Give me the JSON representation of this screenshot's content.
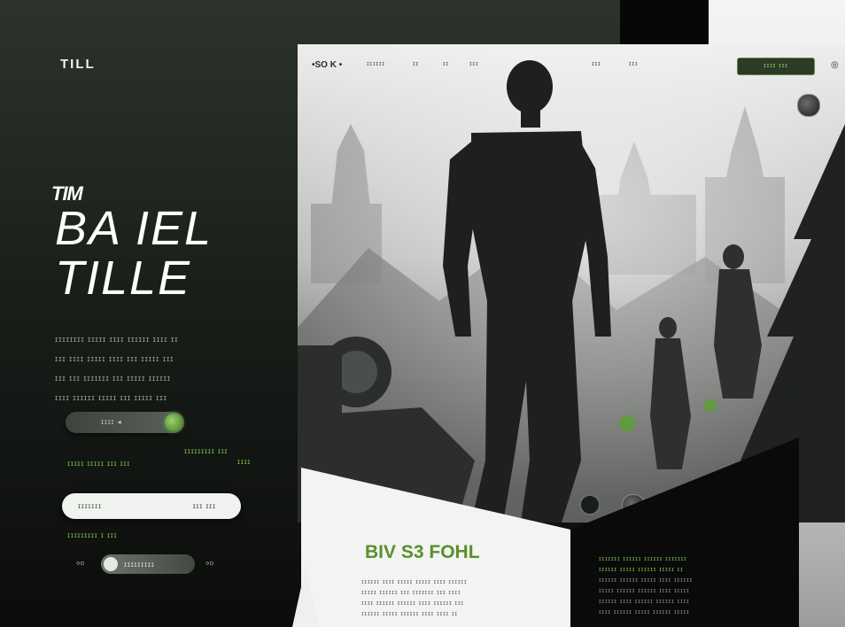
{
  "brand": "TILL",
  "hero": {
    "eyebrow": "TIM",
    "title_line1": "BA IEL",
    "title_line2": "TILLE",
    "description_lines": [
      "ɪɪɪɪɪɪɪɪ ɪɪɪɪɪ ɪɪɪɪ ɪɪɪɪɪɪ ɪɪɪɪ ɪɪ",
      "ɪɪɪ ɪɪɪɪ ɪɪɪɪɪ ɪɪɪɪ ɪɪɪ ɪɪɪɪɪ ɪɪɪ",
      "ɪɪɪ ɪɪɪ ɪɪɪɪɪɪɪ ɪɪɪ ɪɪɪɪɪ ɪɪɪɪɪɪ",
      "ɪɪɪɪ ɪɪɪɪɪɪ ɪɪɪɪɪ ɪɪɪ ɪɪɪɪɪ ɪɪɪ"
    ]
  },
  "controls": {
    "dark_pill_label": "ɪɪɪɪ ◂",
    "green_link_left": "ɪɪɪɪɪ ɪɪɪɪɪ ɪɪɪ ɪɪɪ",
    "green_link_right": "ɪɪɪɪɪɪɪɪɪ ɪɪɪ",
    "green_link_right2": "ɪɪɪɪ",
    "light_pill_left": "ɪɪɪɪɪɪɪ",
    "light_pill_right": "ɪɪɪ ɪɪɪ",
    "green_link_bottom": "ɪɪɪɪɪɪɪɪɪ ɪ ɪɪɪ",
    "mini_left_icon": "◦▫",
    "mini_pill_label": "ɪɪɪɪɪɪɪɪɪ",
    "mini_right_icon": "◦▫"
  },
  "mock": {
    "logo": "•SO K  •",
    "nav_items": [
      "ɪɪɪɪɪɪ",
      "ɪɪ",
      "ɪɪ",
      "ɪɪɪ",
      "ɪɪɪ",
      "ɪɪɪ"
    ],
    "cta": "ɪɪɪɪ ɪɪɪ",
    "corner_icon": "◎",
    "card_title": "BIV S3 FOHL",
    "card_text_lines": [
      "ɪɪɪɪɪɪ ɪɪɪɪ ɪɪɪɪɪ ɪɪɪɪɪ ɪɪɪɪ ɪɪɪɪɪɪ",
      "ɪɪɪɪɪ ɪɪɪɪɪɪ ɪɪɪ ɪɪɪɪɪɪɪ ɪɪɪ ɪɪɪɪ",
      "ɪɪɪɪ ɪɪɪɪɪɪ ɪɪɪɪɪɪ ɪɪɪɪ ɪɪɪɪɪɪ ɪɪɪ",
      "ɪɪɪɪɪɪ ɪɪɪɪɪ ɪɪɪɪɪɪ ɪɪɪɪ ɪɪɪɪ ɪɪ"
    ],
    "dark_heading_lines": [
      "ɪɪɪɪɪɪɪ ɪɪɪɪɪɪ ɪɪɪɪɪɪ ɪɪɪɪɪɪɪ",
      "ɪɪɪɪɪɪ ɪɪɪɪɪ ɪɪɪɪɪɪ ɪɪɪɪɪ ɪɪ"
    ],
    "dark_text_lines": [
      "ɪɪɪɪɪɪ ɪɪɪɪɪɪ ɪɪɪɪɪ ɪɪɪɪ ɪɪɪɪɪɪ",
      "ɪɪɪɪɪ ɪɪɪɪɪɪ ɪɪɪɪɪɪ ɪɪɪɪ ɪɪɪɪɪ",
      "ɪɪɪɪɪɪ ɪɪɪɪ ɪɪɪɪɪɪ ɪɪɪɪɪɪ ɪɪɪɪ",
      "ɪɪɪɪ ɪɪɪɪɪɪ ɪɪɪɪɪ ɪɪɪɪɪɪ ɪɪɪɪɪ"
    ]
  },
  "colors": {
    "accent_green": "#7fc450",
    "dark_bg": "#1a1f1a",
    "light_panel": "#f3f3f3"
  }
}
